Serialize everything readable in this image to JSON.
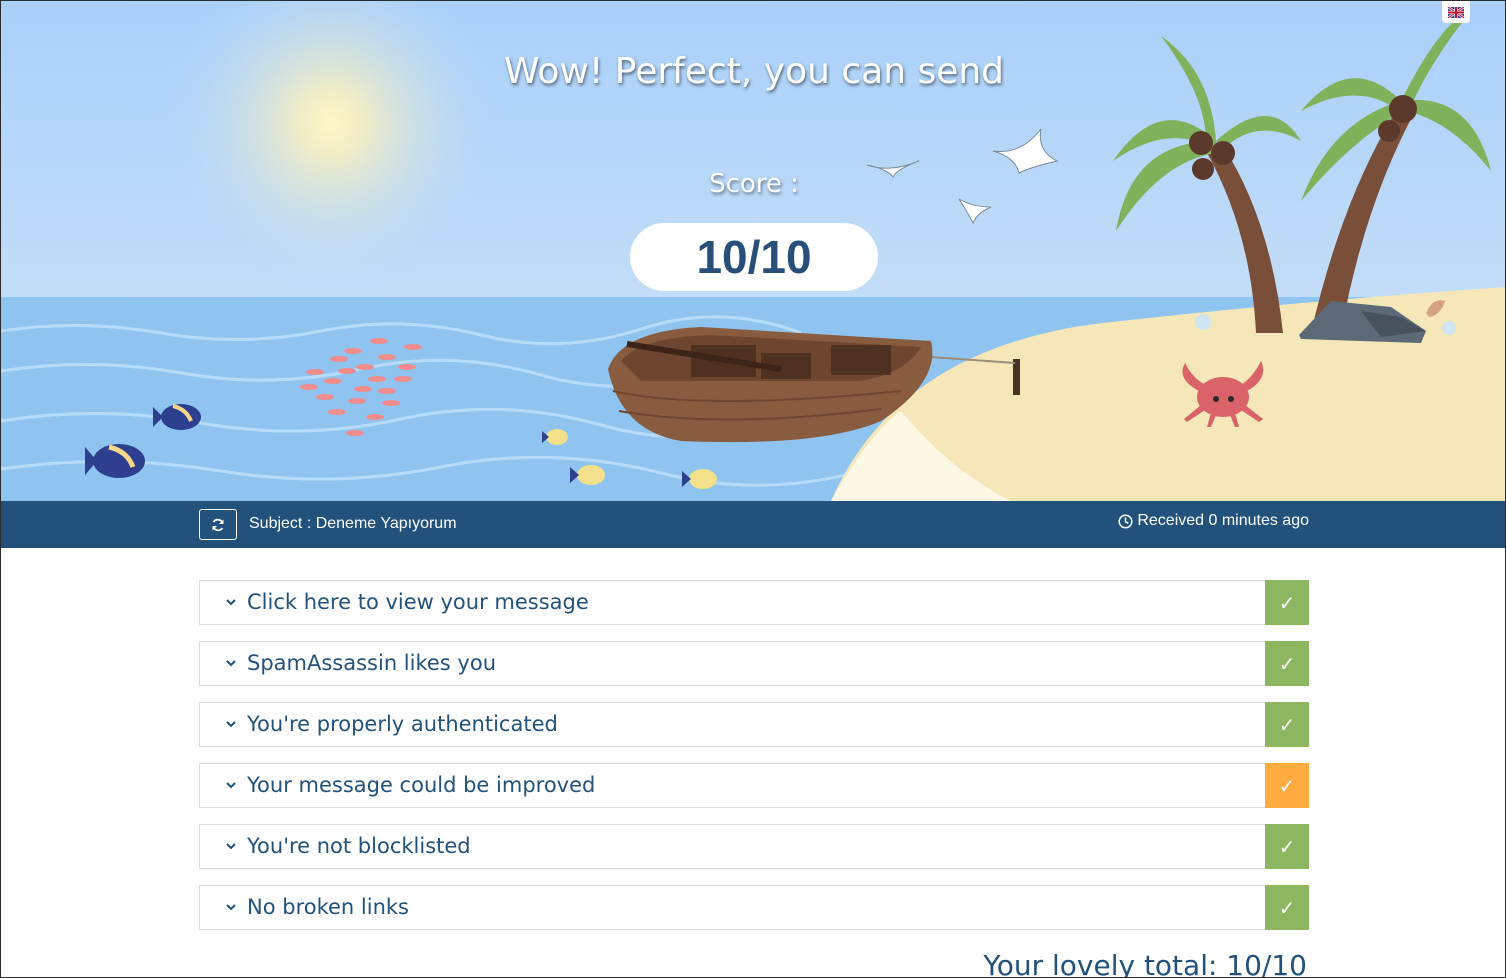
{
  "hero": {
    "title": "Wow! Perfect, you can send",
    "score_label": "Score :",
    "score_value": "10/10"
  },
  "language": {
    "icon": "uk-flag-icon"
  },
  "info_bar": {
    "refresh_icon": "refresh-icon",
    "subject": "Subject : Deneme Yapıyorum",
    "clock_icon": "clock-icon",
    "received": "Received 0 minutes ago"
  },
  "checks": [
    {
      "label": "Click here to view your message",
      "status": "pass"
    },
    {
      "label": "SpamAssassin likes you",
      "status": "pass"
    },
    {
      "label": "You're properly authenticated",
      "status": "pass"
    },
    {
      "label": "Your message could be improved",
      "status": "warning"
    },
    {
      "label": "You're not blocklisted",
      "status": "pass"
    },
    {
      "label": "No broken links",
      "status": "pass"
    }
  ],
  "total": "Your lovely total: 10/10",
  "colors": {
    "brand": "#22527c",
    "pass": "#8db661",
    "warning": "#ffab40",
    "sky": "#b7d8fb",
    "sea": "#8cc3ef",
    "sand": "#f6e7b6"
  }
}
